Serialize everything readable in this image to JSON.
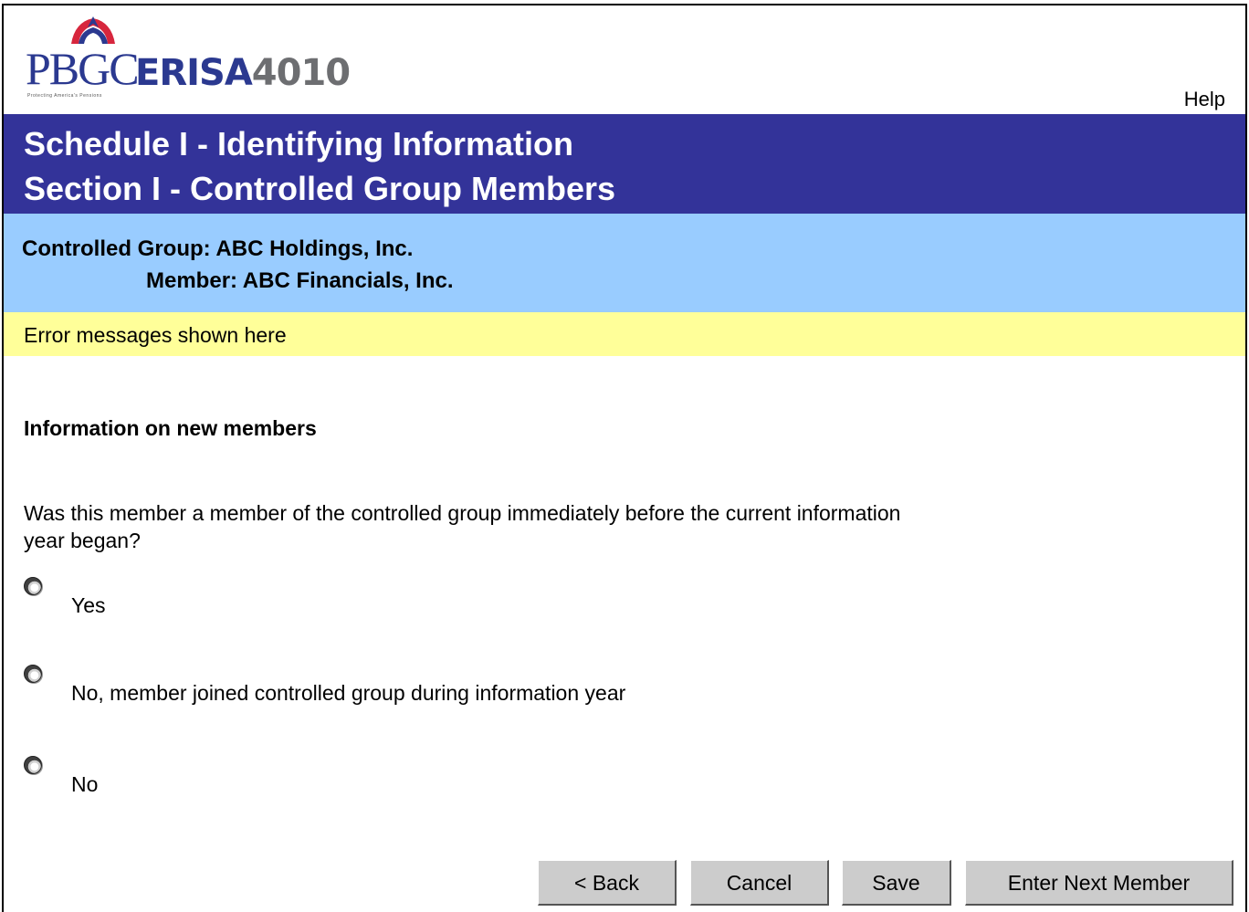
{
  "header": {
    "logo": {
      "brand_text": "PBGC",
      "product_text": "ERISA",
      "product_number": "4010",
      "tagline": "Protecting America's Pensions"
    },
    "help_label": "Help"
  },
  "title": {
    "line1": "Schedule I - Identifying Information",
    "line2": "Section I - Controlled Group Members"
  },
  "context": {
    "controlled_group": "Controlled Group: ABC Holdings, Inc.",
    "member": "Member: ABC Financials, Inc."
  },
  "error_area": {
    "message": "Error messages shown here"
  },
  "form": {
    "section_heading": "Information on new members",
    "question": "Was this member a member of the controlled group immediately before the current information year began?",
    "options": [
      {
        "label": "Yes",
        "selected": false
      },
      {
        "label": "No, member joined controlled group during information year",
        "selected": false
      },
      {
        "label": "No",
        "selected": false
      }
    ]
  },
  "buttons": {
    "back": "< Back",
    "cancel": "Cancel",
    "save": "Save",
    "next": "Enter Next Member"
  },
  "colors": {
    "title_band": "#333399",
    "context_band": "#99ccff",
    "error_band": "#ffff99",
    "button_face": "#cccccc",
    "logo_blue": "#2b3990",
    "logo_gray": "#6d6e71"
  }
}
